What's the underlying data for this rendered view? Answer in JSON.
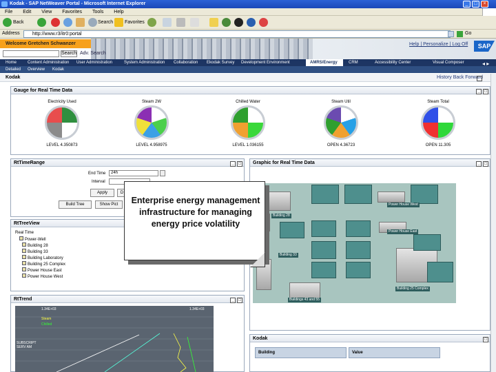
{
  "browser": {
    "title": "Kodak - SAP NetWeaver Portal - Microsoft Internet Explorer",
    "menu": [
      "File",
      "Edit",
      "View",
      "Favorites",
      "Tools",
      "Help"
    ],
    "toolbar": {
      "back": "Back",
      "search": "Search",
      "favorites": "Favorites"
    },
    "address_label": "Address",
    "address_value": "http://www.r3/itr0:portal",
    "go_label": "Go"
  },
  "portal": {
    "welcome": "Welcome Gretchen Schwanzer",
    "search_button": "Search",
    "advanced_search": "Adv. Search",
    "header_links": "Help | Personalize | Log Off",
    "logo": "SAP",
    "top_nav": [
      "Home",
      "Content Administration",
      "User Administration",
      "System Administration",
      "Collaboration",
      "Ekodak Survey",
      "Development Environment",
      "AMRS/Energy",
      "CRM",
      "Accessibility Center",
      "Visual Composer"
    ],
    "active_nav": "AMRS/Energy",
    "sub_nav": [
      "Detailed",
      "Overview",
      "Kodak"
    ],
    "page_title": "Kodak",
    "history": "History  Back  Forward"
  },
  "gauges_panel": {
    "title": "Gauge for Real Time Data",
    "gauges": [
      {
        "label": "Electricity Used",
        "value": "LEVEL 4.350873"
      },
      {
        "label": "Steam 2W",
        "value": "LEVEL 4.958975"
      },
      {
        "label": "Chilled Water",
        "value": "LEVEL 1.036155"
      },
      {
        "label": "Steam Util",
        "value": "OPEN 4.36723"
      },
      {
        "label": "Steam Total",
        "value": "OPEN 11.305"
      }
    ],
    "colors": {
      "gauge1": [
        "#2f8f3f",
        "#ffffff",
        "#8b8b8b",
        "#e84d4d"
      ],
      "gauge2": [
        "#ffffff",
        "#4ccf4c",
        "#3ba0e6",
        "#f0e03a",
        "#8b2fb3"
      ],
      "gauge3": [
        "#ffffff",
        "#3ad83a",
        "#f0a030",
        "#2f9f2f"
      ],
      "gauge4": [
        "#ffffff",
        "#27a0e6",
        "#f0a030",
        "#2f9f2f",
        "#6b4bb0"
      ],
      "gauge5": [
        "#ffffff",
        "#2fd83a",
        "#f03030",
        "#3050e8"
      ]
    }
  },
  "time_range_panel": {
    "title": "RtTimeRange",
    "field1_label": "End Time",
    "field1_value": "24h",
    "field2_label": "Interval",
    "apply_label": "Apply",
    "btn2_label": "D",
    "btn3_label": "Build Tree",
    "btn4_label": "Show Pict"
  },
  "tree_panel": {
    "title": "RtTreeView",
    "root": "Real Time",
    "items": [
      "Power-Well",
      "Building 28",
      "Building 33",
      "Building Laboratory",
      "Building 25 Complex",
      "Power House East",
      "Power House West"
    ]
  },
  "trend_panel": {
    "title": "RtTrend",
    "top_left_value": "1.34E+03",
    "top_right_value": "1.34E+03",
    "series_label_1": "Steam",
    "series_label_2": "Chilled",
    "left_footer": "SUBSCRIPT SERV AM"
  },
  "graphic_panel": {
    "title": "Graphic for Real Time Data",
    "labels": [
      "Power House West",
      "Power House East",
      "Building 28",
      "Building 33",
      "Building 25 Complex",
      "Buildings 43 and 55"
    ]
  },
  "kodak_panel": {
    "title": "Kodak",
    "col1": "Building",
    "col2": "Value"
  },
  "callout": {
    "text": "Enterprise energy management infrastructure for managing energy price volatility"
  }
}
